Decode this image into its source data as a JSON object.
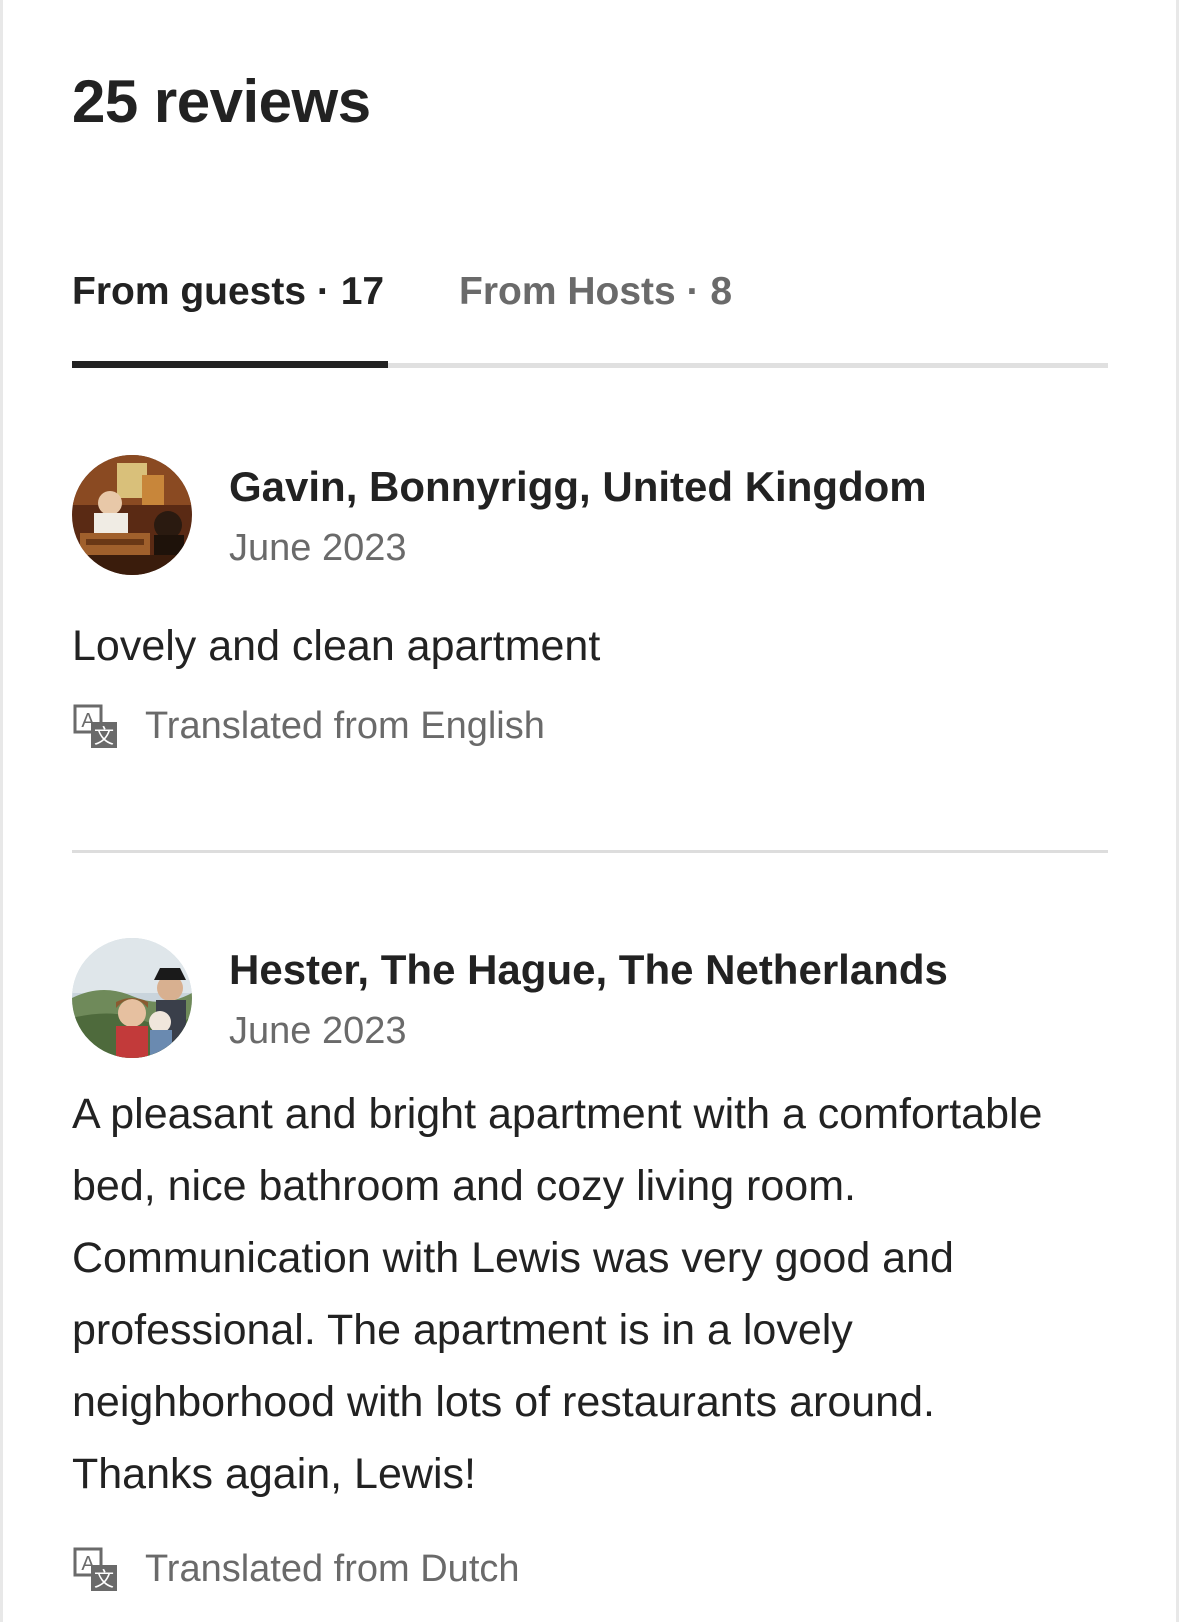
{
  "header": {
    "title": "25 reviews"
  },
  "tabs": [
    {
      "label": "From guests · 17",
      "active": true
    },
    {
      "label": "From Hosts · 8",
      "active": false
    }
  ],
  "reviews": [
    {
      "name": "Gavin, Bonnyrigg, United Kingdom",
      "date": "June 2023",
      "text": "Lovely and clean apartment",
      "translation_note": "Translated from English",
      "translation_icon": "translate-icon"
    },
    {
      "name": "Hester, The Hague, The Netherlands",
      "date": "June 2023",
      "text": "A pleasant and bright apartment with a comfortable bed, nice bathroom and cozy living room. Communication with Lewis was very good and professional. The apartment is in a lovely neighborhood with lots of restaurants around. Thanks again, Lewis!",
      "translation_note": "Translated from Dutch",
      "translation_icon": "translate-icon"
    }
  ],
  "colors": {
    "primary_text": "#222222",
    "secondary_text": "#6a6a6a",
    "divider": "#dddddd",
    "tab_indicator": "#222222"
  }
}
